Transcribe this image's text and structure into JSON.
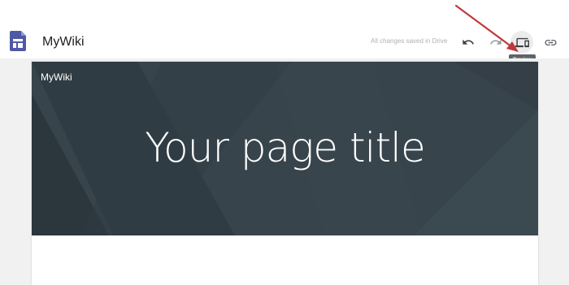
{
  "app": {
    "title": "MyWiki",
    "save_status": "All changes saved in Drive"
  },
  "toolbar": {
    "undo_icon": "undo-icon",
    "redo_icon": "redo-icon",
    "preview_icon": "preview-devices-icon",
    "link_icon": "link-icon",
    "preview_tooltip": "Preview"
  },
  "page": {
    "site_name": "MyWiki",
    "title": "Your page title"
  },
  "colors": {
    "logo": "#4e5aa6",
    "banner": "#37444c",
    "arrow": "#c0383c",
    "tooltip": "#5f6368"
  }
}
